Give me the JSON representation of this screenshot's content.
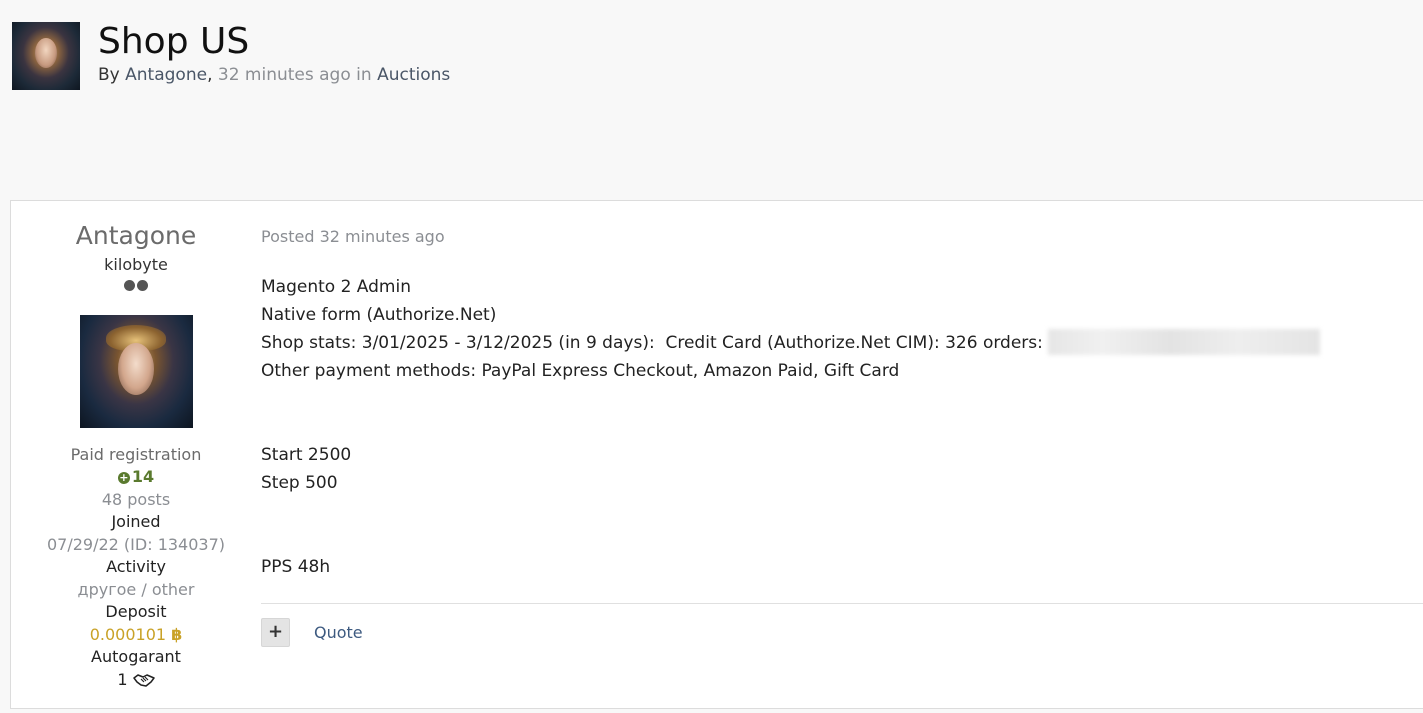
{
  "topic": {
    "title": "Shop US",
    "meta_by": "By",
    "author": "Antagone",
    "comma": ",",
    "time_ago": "32 minutes ago",
    "in_text": "in",
    "forum": "Auctions"
  },
  "author_panel": {
    "name": "Antagone",
    "rank": "kilobyte",
    "rank_dots": 2,
    "group": "Paid registration",
    "reputation": "14",
    "posts": "48 posts",
    "joined_label": "Joined",
    "joined_value": "07/29/22 (ID: 134037)",
    "activity_label": "Activity",
    "activity_value": "другое / other",
    "deposit_label": "Deposit",
    "deposit_value": "0.000101",
    "deposit_icon": "bitcoin-icon",
    "autogarant_label": "Autogarant",
    "autogarant_value": "1",
    "autogarant_icon": "handshake-icon"
  },
  "post": {
    "posted": "Posted 32 minutes ago",
    "lines": [
      "Magento 2 Admin",
      "Native form (Authorize.Net)",
      "Shop stats: 3/01/2025 - 3/12/2025 (in 9 days):  Credit Card (Authorize.Net CIM): 326 orders: ",
      "Other payment methods: PayPal Express Checkout, Amazon Paid, Gift Card",
      "",
      "",
      "Start 2500",
      "Step 500",
      "",
      "",
      "PPS 48h"
    ],
    "plus_label": "+",
    "quote_label": "Quote"
  },
  "colors": {
    "background": "#f8f8f8",
    "reputation": "#5a7a2e",
    "deposit": "#c9a227",
    "link": "#3d5a80",
    "muted": "#8b8e93"
  }
}
